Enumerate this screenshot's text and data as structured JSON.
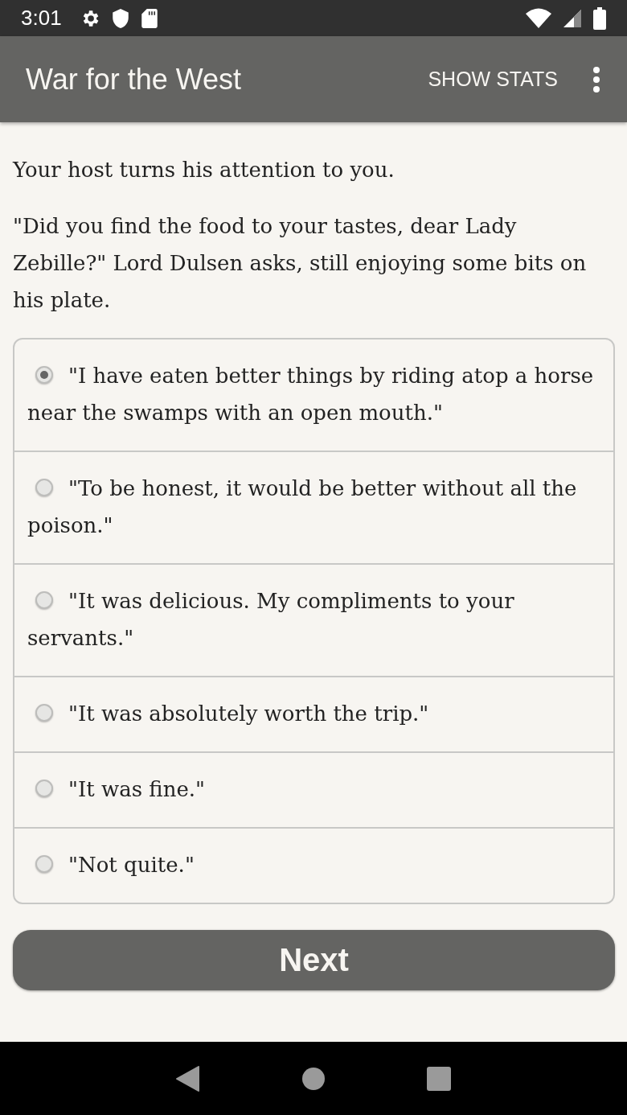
{
  "status_bar": {
    "time": "3:01"
  },
  "app_bar": {
    "title": "War for the West",
    "action": "SHOW STATS"
  },
  "paragraphs": [
    "Your host turns his attention to you.",
    "\"Did you find the food to your tastes, dear Lady Zebille?\" Lord Dulsen asks, still enjoying some bits on his plate."
  ],
  "choices": [
    {
      "label": "\"I have eaten better things by riding atop a horse near the swamps with an open mouth.\"",
      "selected": true
    },
    {
      "label": "\"To be honest, it would be better without all the poison.\"",
      "selected": false
    },
    {
      "label": "\"It was delicious. My compliments to your servants.\"",
      "selected": false
    },
    {
      "label": "\"It was absolutely worth the trip.\"",
      "selected": false
    },
    {
      "label": "\"It was fine.\"",
      "selected": false
    },
    {
      "label": "\"Not quite.\"",
      "selected": false
    }
  ],
  "next_button": "Next"
}
